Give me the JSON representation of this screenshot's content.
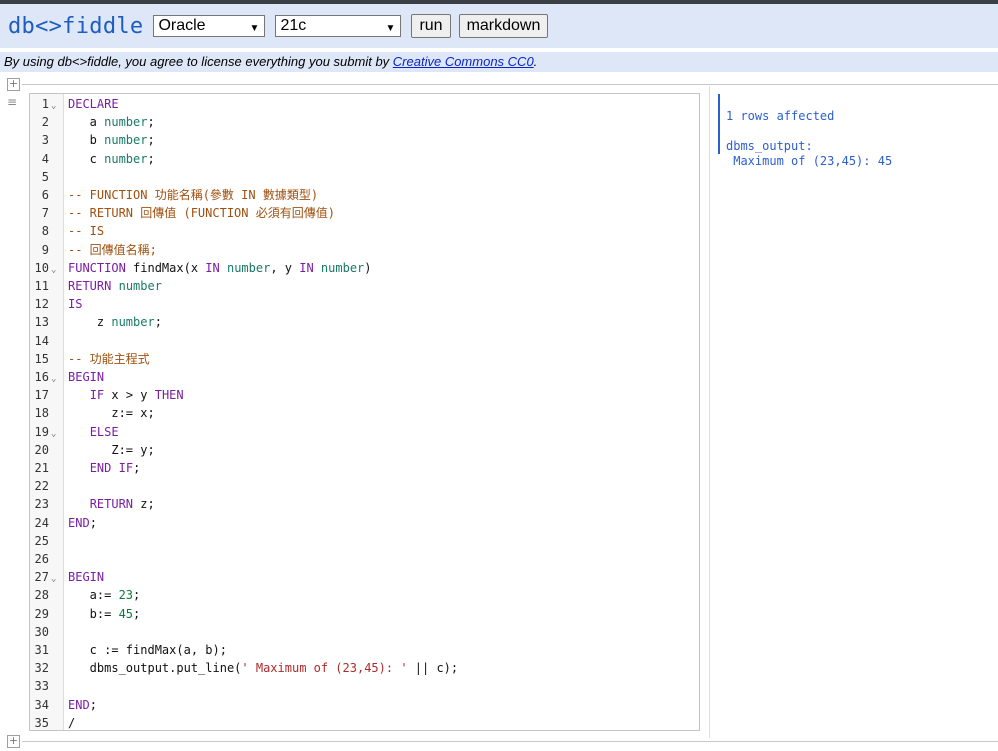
{
  "header": {
    "logo": "db<>fiddle",
    "db_engine": "Oracle",
    "db_version": "21c",
    "run_label": "run",
    "markdown_label": "markdown"
  },
  "license": {
    "text": "By using db<>fiddle, you agree to license everything you submit by ",
    "link": "Creative Commons CC0",
    "suffix": "."
  },
  "icons": {
    "plus": "+",
    "menu": "≡",
    "fold": "⌄",
    "caret": "▼"
  },
  "editor": {
    "lines": [
      {
        "n": "1",
        "fold": true,
        "parts": [
          [
            "kw",
            "DECLARE"
          ]
        ]
      },
      {
        "n": "2",
        "parts": [
          [
            "pl",
            "   a "
          ],
          [
            "ty",
            "number"
          ],
          [
            "pl",
            ";"
          ]
        ]
      },
      {
        "n": "3",
        "parts": [
          [
            "pl",
            "   b "
          ],
          [
            "ty",
            "number"
          ],
          [
            "pl",
            ";"
          ]
        ]
      },
      {
        "n": "4",
        "parts": [
          [
            "pl",
            "   c "
          ],
          [
            "ty",
            "number"
          ],
          [
            "pl",
            ";"
          ]
        ]
      },
      {
        "n": "5",
        "parts": []
      },
      {
        "n": "6",
        "parts": [
          [
            "cm",
            "-- FUNCTION 功能名稱(參數 IN 數據類型)"
          ]
        ]
      },
      {
        "n": "7",
        "parts": [
          [
            "cm",
            "-- RETURN 回傳值 (FUNCTION 必須有回傳值)"
          ]
        ]
      },
      {
        "n": "8",
        "parts": [
          [
            "cm",
            "-- IS"
          ]
        ]
      },
      {
        "n": "9",
        "parts": [
          [
            "cm",
            "-- 回傳值名稱;"
          ]
        ]
      },
      {
        "n": "10",
        "fold": true,
        "parts": [
          [
            "kw",
            "FUNCTION"
          ],
          [
            "pl",
            " findMax(x "
          ],
          [
            "kw",
            "IN"
          ],
          [
            "pl",
            " "
          ],
          [
            "ty",
            "number"
          ],
          [
            "pl",
            ", y "
          ],
          [
            "kw",
            "IN"
          ],
          [
            "pl",
            " "
          ],
          [
            "ty",
            "number"
          ],
          [
            "pl",
            ")"
          ]
        ]
      },
      {
        "n": "11",
        "parts": [
          [
            "kw",
            "RETURN"
          ],
          [
            "pl",
            " "
          ],
          [
            "ty",
            "number"
          ]
        ]
      },
      {
        "n": "12",
        "parts": [
          [
            "kw",
            "IS"
          ]
        ]
      },
      {
        "n": "13",
        "parts": [
          [
            "pl",
            "    z "
          ],
          [
            "ty",
            "number"
          ],
          [
            "pl",
            ";"
          ]
        ]
      },
      {
        "n": "14",
        "parts": []
      },
      {
        "n": "15",
        "parts": [
          [
            "cm",
            "-- 功能主程式"
          ]
        ]
      },
      {
        "n": "16",
        "fold": true,
        "parts": [
          [
            "kw",
            "BEGIN"
          ]
        ]
      },
      {
        "n": "17",
        "parts": [
          [
            "pl",
            "   "
          ],
          [
            "kw",
            "IF"
          ],
          [
            "pl",
            " x > y "
          ],
          [
            "kw",
            "THEN"
          ]
        ]
      },
      {
        "n": "18",
        "parts": [
          [
            "pl",
            "      z:= x;"
          ]
        ]
      },
      {
        "n": "19",
        "fold": true,
        "parts": [
          [
            "pl",
            "   "
          ],
          [
            "kw",
            "ELSE"
          ]
        ]
      },
      {
        "n": "20",
        "parts": [
          [
            "pl",
            "      Z:= y;"
          ]
        ]
      },
      {
        "n": "21",
        "parts": [
          [
            "pl",
            "   "
          ],
          [
            "kw",
            "END"
          ],
          [
            "pl",
            " "
          ],
          [
            "kw",
            "IF"
          ],
          [
            "pl",
            ";"
          ]
        ]
      },
      {
        "n": "22",
        "parts": []
      },
      {
        "n": "23",
        "parts": [
          [
            "pl",
            "   "
          ],
          [
            "kw",
            "RETURN"
          ],
          [
            "pl",
            " z;"
          ]
        ]
      },
      {
        "n": "24",
        "parts": [
          [
            "kw",
            "END"
          ],
          [
            "pl",
            ";"
          ]
        ]
      },
      {
        "n": "25",
        "parts": []
      },
      {
        "n": "26",
        "parts": []
      },
      {
        "n": "27",
        "fold": true,
        "parts": [
          [
            "kw",
            "BEGIN"
          ]
        ]
      },
      {
        "n": "28",
        "parts": [
          [
            "pl",
            "   a:= "
          ],
          [
            "nm",
            "23"
          ],
          [
            "pl",
            ";"
          ]
        ]
      },
      {
        "n": "29",
        "parts": [
          [
            "pl",
            "   b:= "
          ],
          [
            "nm",
            "45"
          ],
          [
            "pl",
            ";"
          ]
        ]
      },
      {
        "n": "30",
        "parts": []
      },
      {
        "n": "31",
        "parts": [
          [
            "pl",
            "   c := findMax(a, b);"
          ]
        ]
      },
      {
        "n": "32",
        "parts": [
          [
            "pl",
            "   dbms_output.put_line("
          ],
          [
            "str",
            "' Maximum of (23,45): '"
          ],
          [
            "pl",
            " || c);"
          ]
        ]
      },
      {
        "n": "33",
        "parts": []
      },
      {
        "n": "34",
        "parts": [
          [
            "kw",
            "END"
          ],
          [
            "pl",
            ";"
          ]
        ]
      },
      {
        "n": "35",
        "parts": [
          [
            "pl",
            "/"
          ]
        ]
      }
    ]
  },
  "result": {
    "rows_affected": "1 rows affected",
    "output_label": "dbms_output:",
    "output_value": " Maximum of (23,45): 45"
  },
  "colors": {
    "accent": "#1f5cc2",
    "header_bg": "#dde7f7",
    "keyword": "#7a1fa2",
    "type": "#1a7a67",
    "comment": "#a0500f",
    "number": "#0b7a3b",
    "string": "#b02a2a"
  }
}
